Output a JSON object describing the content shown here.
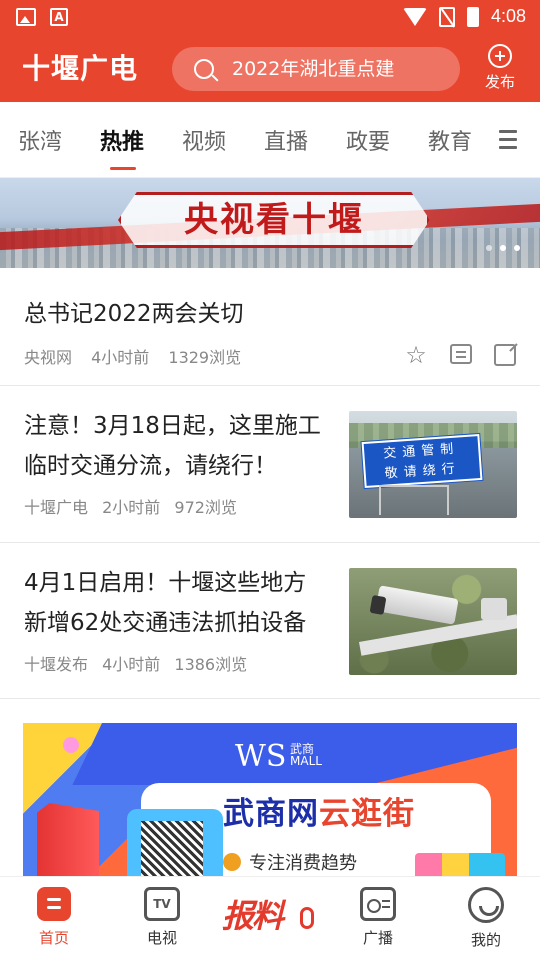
{
  "status_bar": {
    "time": "4:08",
    "left_icons": [
      "image-icon",
      "a-icon"
    ],
    "right_icons": [
      "wifi-icon",
      "no-sim-icon",
      "battery-icon"
    ],
    "a_glyph": "A"
  },
  "header": {
    "brand": "十堰广电",
    "search_placeholder": "2022年湖北重点建",
    "publish_label": "发布"
  },
  "tabs": {
    "items": [
      "张湾",
      "热推",
      "视频",
      "直播",
      "政要",
      "教育"
    ],
    "active_index": 1
  },
  "banner": {
    "title": "央视看十堰",
    "slides_count": 3,
    "active_slide": 2
  },
  "articles": [
    {
      "title": "总书记2022两会关切",
      "source": "央视网",
      "time": "4小时前",
      "views": "1329浏览",
      "actions": [
        "star-icon",
        "comment-icon",
        "share-icon"
      ]
    },
    {
      "title": "注意！3月18日起，这里施工临时交通分流，请绕行！",
      "source": "十堰广电",
      "time": "2小时前",
      "views": "972浏览",
      "thumb_sign_line1": "交通管制",
      "thumb_sign_line2": "敬请绕行"
    },
    {
      "title": "4月1日启用！十堰这些地方新增62处交通违法抓拍设备",
      "source": "十堰发布",
      "time": "4小时前",
      "views": "1386浏览"
    }
  ],
  "ad": {
    "logo": "WS",
    "logo_cn": "武商",
    "logo_mall": "MALL",
    "title_part1": "武商网",
    "title_part2": "云逛街",
    "subtitle": "专注消费趋势",
    "colors": {
      "yellow": "#ffd43b",
      "blue": "#3c5cea",
      "orange": "#ff6a3d",
      "navy": "#1c2fa8"
    }
  },
  "bottom_nav": {
    "items": [
      {
        "label": "首页",
        "icon": "home-icon",
        "active": true
      },
      {
        "label": "电视",
        "icon": "tv-icon",
        "active": false
      },
      {
        "label": "广播",
        "icon": "radio-icon",
        "active": false
      },
      {
        "label": "我的",
        "icon": "me-icon",
        "active": false
      }
    ],
    "report_label": "报料",
    "tv_glyph": "TV"
  },
  "colors": {
    "brand_red": "#e8452f",
    "text_primary": "#222222",
    "text_meta": "#888888"
  }
}
